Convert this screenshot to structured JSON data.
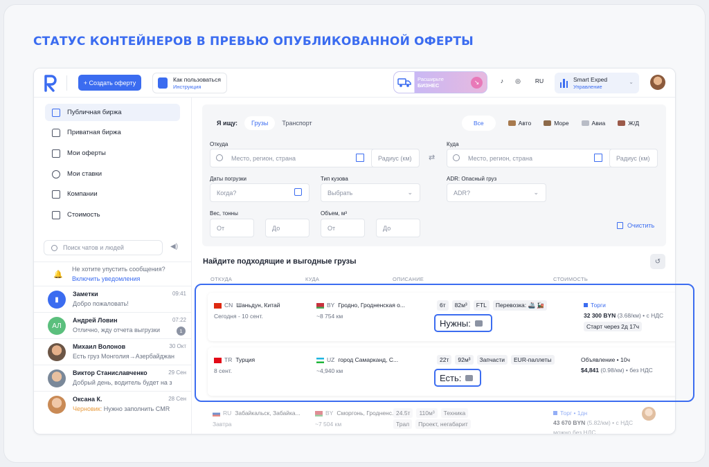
{
  "headline": "СТАТУС КОНТЕЙНЕРОВ В ПРЕВЬЮ ОПУБЛИКОВАННОЙ ОФЕРТЫ",
  "topbar": {
    "create_label": "+ Создать оферту",
    "howto_title": "Как пользоваться",
    "howto_sub": "Инструкция",
    "biz_line1": "Расширьте",
    "biz_line2": "БИЗНЕС",
    "lang": "RU",
    "company_name": "Smart Exped",
    "company_sub": "Управление"
  },
  "sidebar": {
    "items": [
      {
        "label": "Публичная биржа"
      },
      {
        "label": "Приватная биржа"
      },
      {
        "label": "Мои оферты"
      },
      {
        "label": "Мои ставки"
      },
      {
        "label": "Компании"
      },
      {
        "label": "Стоимость"
      }
    ],
    "search_placeholder": "Поиск чатов и людей",
    "notify_text": "Не хотите упустить сообщения?",
    "notify_link": "Включить уведомления",
    "chats": [
      {
        "name": "Заметки",
        "time": "09:41",
        "msg": "Добро пожаловать!"
      },
      {
        "name": "Андрей Ловин",
        "time": "07:22",
        "msg": "Отлично, жду отчета выгрузки",
        "initials": "АЛ",
        "badge": "1"
      },
      {
        "name": "Михаил Волонов",
        "time": "30 Окт",
        "msg": "Есть груз Монголия→Азербайджан"
      },
      {
        "name": "Виктор Станиславченко",
        "time": "29 Сен",
        "msg": "Добрый день, водитель будет на з"
      },
      {
        "name": "Оксана К.",
        "time": "28 Сен",
        "draft": "Черновик:",
        "msg": "Нужно заполнить CMR"
      }
    ]
  },
  "filters": {
    "looking_label": "Я ищу:",
    "tab_cargo": "Грузы",
    "tab_transport": "Транспорт",
    "mode_all": "Все",
    "modes": [
      "Авто",
      "Море",
      "Авиа",
      "Ж/Д"
    ],
    "from_label": "Откуда",
    "from_placeholder": "Место, регион, страна",
    "radius_placeholder": "Радиус (км)",
    "to_label": "Куда",
    "to_placeholder": "Место, регион, страна",
    "dates_label": "Даты погрузки",
    "dates_placeholder": "Когда?",
    "body_label": "Тип кузова",
    "body_placeholder": "Выбрать",
    "adr_label": "ADR: Опасный груз",
    "adr_placeholder": "ADR?",
    "weight_label": "Вес, тонны",
    "volume_label": "Объем, м³",
    "from_ph": "От",
    "to_ph": "До",
    "clear_label": "Очистить"
  },
  "results": {
    "title": "Найдите подходящие и выгодные грузы",
    "headers": [
      "ОТКУДА",
      "КУДА",
      "ОПИСАНИЕ",
      "СТОИМОСТЬ"
    ],
    "offers": [
      {
        "from_cc": "CN",
        "from": "Шаньдун, Китай",
        "date": "Сегодня - 10 сент.",
        "to_cc": "BY",
        "to": "Гродно, Гродненская о...",
        "dist": "~8 754 км",
        "chips": [
          "6т",
          "82м³",
          "FTL",
          "Перевозка: 🚢 🚂"
        ],
        "status": "Нужны:",
        "price_type": "Торги",
        "price": "32 300 BYN",
        "price_rate": "(3.68/км) • с НДС",
        "start": "Старт через 2д 17ч"
      },
      {
        "from_cc": "TR",
        "from": "Турция",
        "date": "8 сент.",
        "to_cc": "UZ",
        "to": "город Самарканд, С...",
        "dist": "~4,940 км",
        "chips": [
          "22т",
          "92м³",
          "Запчасти",
          "EUR-паллеты"
        ],
        "status": "Есть:",
        "price_type": "Объявление • 10ч",
        "price": "$4,841",
        "price_rate": "(0.98/км) • без НДС"
      },
      {
        "from_cc": "RU",
        "from": "Забайкальск, Забайка...",
        "date": "Завтра",
        "to_cc": "BY",
        "to": "Сморгонь, Гродненс...",
        "dist": "~7 504 км",
        "chips": [
          "24.5т",
          "110м³",
          "Техника"
        ],
        "chips2": [
          "Трал",
          "Проект, негабарит"
        ],
        "price_type": "Торг • 1дн",
        "price": "43 670 BYN",
        "price_rate": "(5.82/км) • с НДС",
        "extra": "можно без НДС"
      }
    ]
  },
  "colors": {
    "accent": "#3b6cf0",
    "highlight_border": "#3b6cf0"
  }
}
